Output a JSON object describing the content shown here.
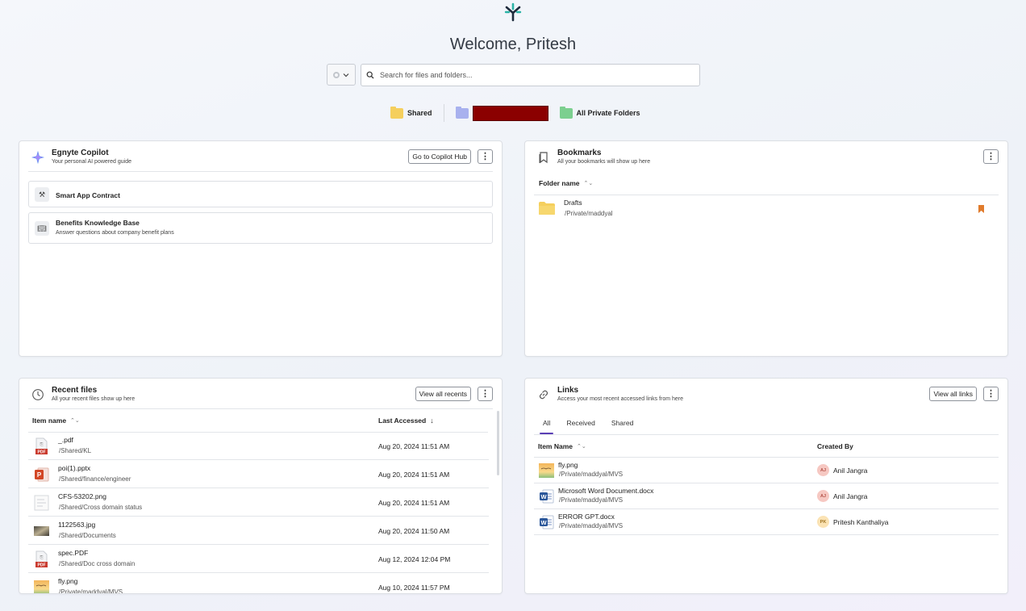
{
  "header": {
    "logo_icon": "egnyte-logo-icon",
    "welcome": "Welcome, Pritesh",
    "search_placeholder": "Search for files and folders..."
  },
  "quick_folders": [
    {
      "label": "Shared",
      "color": "#f5cf5d"
    },
    {
      "label": "",
      "color": "#a8b1ee",
      "redacted": true
    },
    {
      "label": "All Private Folders",
      "color": "#7ccf8f"
    }
  ],
  "copilot": {
    "title": "Egnyte Copilot",
    "subtitle": "Your personal AI powered guide",
    "hub_button": "Go to Copilot Hub",
    "items": [
      {
        "label": "Smart App Contract",
        "description": "",
        "icon": "tools-icon"
      },
      {
        "label": "Benefits Knowledge Base",
        "description": "Answer questions about company benefit plans",
        "icon": "book-icon"
      }
    ]
  },
  "bookmarks": {
    "title": "Bookmarks",
    "subtitle": "All your bookmarks will show up here",
    "column": "Folder name",
    "items": [
      {
        "name": "Drafts",
        "path": "/Private/maddyal"
      }
    ]
  },
  "recent": {
    "title": "Recent files",
    "subtitle": "All your recent files show up here",
    "view_all": "View all recents",
    "columns": {
      "name": "Item name",
      "accessed": "Last Accessed"
    },
    "files": [
      {
        "name": "_.pdf",
        "path": "/Shared/KL",
        "date": "Aug 20, 2024 11:51 AM",
        "type": "pdf"
      },
      {
        "name": "poi(1).pptx",
        "path": "/Shared/finance/engineer",
        "date": "Aug 20, 2024 11:51 AM",
        "type": "pptx"
      },
      {
        "name": "CFS-53202.png",
        "path": "/Shared/Cross domain status",
        "date": "Aug 20, 2024 11:51 AM",
        "type": "png-doc"
      },
      {
        "name": "1122563.jpg",
        "path": "/Shared/Documents",
        "date": "Aug 20, 2024 11:50 AM",
        "type": "jpg"
      },
      {
        "name": "spec.PDF",
        "path": "/Shared/Doc cross domain",
        "date": "Aug 12, 2024 12:04 PM",
        "type": "pdf"
      },
      {
        "name": "fly.png",
        "path": "/Private/maddyal/MVS",
        "date": "Aug 10, 2024 11:57 PM",
        "type": "png-image"
      }
    ]
  },
  "links": {
    "title": "Links",
    "subtitle": "Access your most recent accessed links from here",
    "view_all": "View all links",
    "tabs": [
      "All",
      "Received",
      "Shared"
    ],
    "active_tab": "All",
    "columns": {
      "name": "Item Name",
      "creator": "Created By"
    },
    "items": [
      {
        "name": "fly.png",
        "path": "/Private/maddyal/MVS",
        "creator": "Anil Jangra",
        "initials": "AJ",
        "type": "png-image"
      },
      {
        "name": "Microsoft Word Document.docx",
        "path": "/Private/maddyal/MVS",
        "creator": "Anil Jangra",
        "initials": "AJ",
        "type": "docx"
      },
      {
        "name": "ERROR GPT.docx",
        "path": "/Private/maddyal/MVS",
        "creator": "Pritesh Kanthaliya",
        "initials": "PK",
        "type": "docx"
      }
    ]
  },
  "colors": {
    "pdf": "#c93a2e",
    "pptx": "#d24726",
    "docx": "#2b579a",
    "bookmark": "#e07b2c",
    "accent": "#5a3fb5",
    "avatar_aj": "#f6c8c2",
    "avatar_pk": "#fbe3b4"
  }
}
